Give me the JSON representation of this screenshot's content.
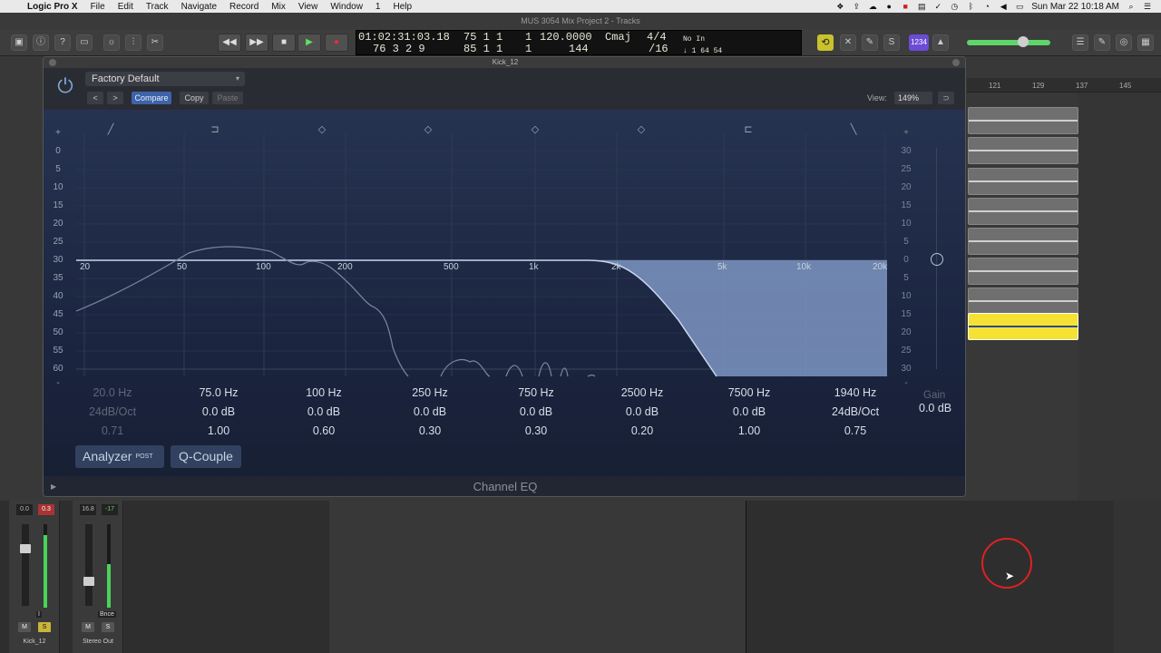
{
  "menubar": {
    "apple": "",
    "app_name": "Logic Pro X",
    "items": [
      "File",
      "Edit",
      "Track",
      "Navigate",
      "Record",
      "Mix",
      "View",
      "Window",
      "1",
      "Help"
    ],
    "clock": "Sun Mar 22  10:18 AM"
  },
  "window": {
    "title": "MUS 3054 Mix Project 2 - Tracks"
  },
  "lcd": {
    "timecode": "01:02:31:03.18",
    "timecode_sub": "76  3  2      9",
    "bars": "75  1  1",
    "bars_sub": "85  1  1",
    "beat": "1",
    "beat_sub": "1",
    "tempo": "120.0000",
    "tempo_sub": "144",
    "key": "Cmaj",
    "sig": "4/4",
    "sig_sub": "/16",
    "input": "No In",
    "input_sub": "↓ 1  64  54"
  },
  "count_btn": "1234",
  "ruler": {
    "marks": [
      "121",
      "129",
      "137",
      "145"
    ]
  },
  "plugin": {
    "window_title": "Kick_12",
    "preset": "Factory Default",
    "nav_prev": "<",
    "nav_next": ">",
    "compare": "Compare",
    "copy": "Copy",
    "paste": "Paste",
    "view_label": "View:",
    "view_value": "149%",
    "link_icon": "link-icon",
    "footer": "Channel EQ",
    "analyzer": "Analyzer",
    "analyzer_post": "POST",
    "q_couple": "Q-Couple",
    "gain_label": "Gain",
    "gain_value": "0.0 dB",
    "db_scale_left": [
      "+",
      "0",
      "5",
      "10",
      "15",
      "20",
      "25",
      "30",
      "35",
      "40",
      "45",
      "50",
      "55",
      "60",
      "-"
    ],
    "db_scale_right": [
      "+",
      "30",
      "25",
      "20",
      "15",
      "10",
      "5",
      "0",
      "5",
      "10",
      "15",
      "20",
      "25",
      "30",
      "-"
    ],
    "freq_labels": [
      "20",
      "50",
      "100",
      "200",
      "500",
      "1k",
      "2k",
      "5k",
      "10k",
      "20k"
    ],
    "bands": [
      {
        "freq": "20.0 Hz",
        "gain": "24dB/Oct",
        "q": "0.71",
        "enabled": false,
        "icon": "low-cut-icon"
      },
      {
        "freq": "75.0 Hz",
        "gain": "0.0 dB",
        "q": "1.00",
        "enabled": true,
        "icon": "low-shelf-icon"
      },
      {
        "freq": "100 Hz",
        "gain": "0.0 dB",
        "q": "0.60",
        "enabled": true,
        "icon": "bell-icon"
      },
      {
        "freq": "250 Hz",
        "gain": "0.0 dB",
        "q": "0.30",
        "enabled": true,
        "icon": "bell-icon"
      },
      {
        "freq": "750 Hz",
        "gain": "0.0 dB",
        "q": "0.30",
        "enabled": true,
        "icon": "bell-icon"
      },
      {
        "freq": "2500 Hz",
        "gain": "0.0 dB",
        "q": "0.20",
        "enabled": true,
        "icon": "bell-icon"
      },
      {
        "freq": "7500 Hz",
        "gain": "0.0 dB",
        "q": "1.00",
        "enabled": true,
        "icon": "high-shelf-icon"
      },
      {
        "freq": "1940 Hz",
        "gain": "24dB/Oct",
        "q": "0.75",
        "enabled": true,
        "icon": "high-cut-icon"
      }
    ]
  },
  "mixer": {
    "strips": [
      {
        "name": "Kick_12",
        "peak_a": "0.0",
        "peak_b": "0.3",
        "mute": "M",
        "solo": "S",
        "input": "I"
      },
      {
        "name": "Stereo Out",
        "peak_a": "16.8",
        "peak_b": "-17",
        "mute": "M",
        "solo": "S",
        "label": "Bnce"
      }
    ]
  },
  "colors": {
    "accent": "#3d63a8",
    "eq_fill": "#7d95c2",
    "region_selected": "#f5e233",
    "meter": "#49d45a"
  }
}
